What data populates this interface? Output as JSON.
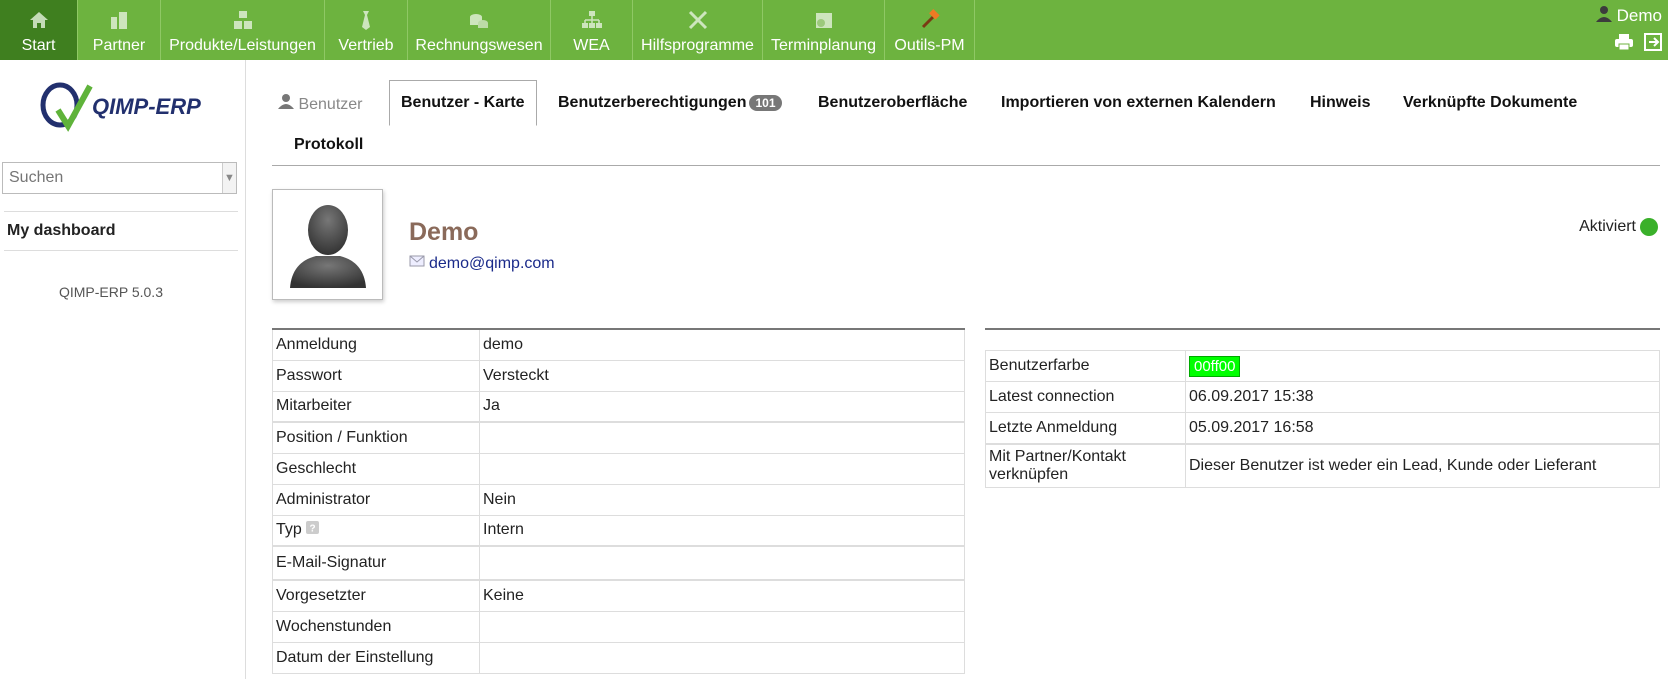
{
  "nav": [
    {
      "label": "Start",
      "icon": "home-icon",
      "active": true
    },
    {
      "label": "Partner",
      "icon": "partner-icon"
    },
    {
      "label": "Produkte/Leistungen",
      "icon": "products-icon"
    },
    {
      "label": "Vertrieb",
      "icon": "tie-icon"
    },
    {
      "label": "Rechnungswesen",
      "icon": "coins-icon"
    },
    {
      "label": "WEA",
      "icon": "hierarchy-icon"
    },
    {
      "label": "Hilfsprogramme",
      "icon": "tools-icon"
    },
    {
      "label": "Terminplanung",
      "icon": "calendar-icon"
    },
    {
      "label": "Outils-PM",
      "icon": "hammer-icon"
    }
  ],
  "user": {
    "name": "Demo"
  },
  "sidebar": {
    "logo_text": "QIMP-ERP",
    "search_placeholder": "Suchen",
    "dashboard": "My dashboard",
    "version": "QIMP-ERP 5.0.3"
  },
  "tabs": {
    "benutzer": "Benutzer",
    "karte": "Benutzer - Karte",
    "rechte": "Benutzerberechtigungen",
    "rechte_count": "101",
    "oberflaeche": "Benutzeroberfläche",
    "kalender": "Importieren von externen Kalendern",
    "hinweis": "Hinweis",
    "dokumente": "Verknüpfte Dokumente",
    "protokoll": "Protokoll"
  },
  "profile": {
    "name": "Demo",
    "email": "demo@qimp.com",
    "status": "Aktiviert"
  },
  "left_table": [
    {
      "k": "Anmeldung",
      "v": "demo"
    },
    {
      "k": "Passwort",
      "v": "Versteckt"
    },
    {
      "k": "Mitarbeiter",
      "v": "Ja"
    },
    {
      "k": "Position / Funktion",
      "v": ""
    },
    {
      "k": "Geschlecht",
      "v": ""
    },
    {
      "k": "Administrator",
      "v": "Nein"
    },
    {
      "k": "Typ",
      "v": "Intern"
    },
    {
      "k": "E-Mail-Signatur",
      "v": ""
    },
    {
      "k": "Vorgesetzter",
      "v": "Keine"
    },
    {
      "k": "Wochenstunden",
      "v": ""
    },
    {
      "k": "Datum der Einstellung",
      "v": ""
    }
  ],
  "right_table": [
    {
      "k": "Benutzerfarbe",
      "v": "00ff00"
    },
    {
      "k": "Latest connection",
      "v": "06.09.2017 15:38"
    },
    {
      "k": "Letzte Anmeldung",
      "v": "05.09.2017 16:58"
    },
    {
      "k": "Mit Partner/Kontakt verknüpfen",
      "v": "Dieser Benutzer ist weder ein Lead, Kunde oder Lieferant"
    }
  ],
  "colors": {
    "accent": "#6db33f",
    "active_nav": "#3f7f1f",
    "user_color": "#00ff00"
  }
}
